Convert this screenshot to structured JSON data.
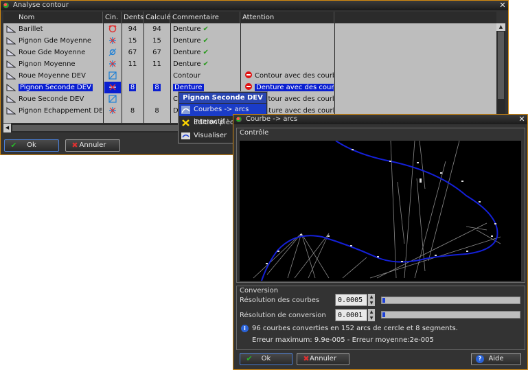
{
  "w1": {
    "title": "Analyse contour",
    "columns": [
      "Nom",
      "Cin.",
      "Dents",
      "Calculé",
      "Commentaire",
      "Attention"
    ],
    "rows": [
      {
        "name": "Barillet",
        "dents": "94",
        "calcule": "94",
        "comment": "Denture",
        "ok": true,
        "warning": ""
      },
      {
        "name": "Pignon Gde Moyenne",
        "dents": "15",
        "calcule": "15",
        "comment": "Denture",
        "ok": true,
        "warning": ""
      },
      {
        "name": "Roue Gde Moyenne",
        "dents": "67",
        "calcule": "67",
        "comment": "Denture",
        "ok": true,
        "warning": ""
      },
      {
        "name": "Pignon Moyenne",
        "dents": "11",
        "calcule": "11",
        "comment": "Denture",
        "ok": true,
        "warning": ""
      },
      {
        "name": "Roue Moyenne DEV",
        "dents": "",
        "calcule": "",
        "comment": "Contour",
        "ok": false,
        "warning": "Contour avec des courbes"
      },
      {
        "name": "Pignon Seconde DEV",
        "dents": "8",
        "calcule": "8",
        "comment": "Denture",
        "ok": false,
        "warning": "Denture avec des courbes",
        "selected": true
      },
      {
        "name": "Roue Seconde DEV",
        "dents": "",
        "calcule": "",
        "comment": "Co",
        "ok": false,
        "warning": "Contour avec des courbes"
      },
      {
        "name": "Pignon Echappement DEV",
        "dents": "8",
        "calcule": "8",
        "comment": "De",
        "ok": false,
        "warning": "Denture avec des courbes"
      }
    ],
    "ok_label": "Ok",
    "cancel_label": "Annuler"
  },
  "context_menu": {
    "header": "Pignon Seconde DEV",
    "items": [
      "Courbes -> arcs interactif",
      "Edition pièce",
      "Visualiser"
    ]
  },
  "w2": {
    "title": "Courbe -> arcs",
    "group_control": "Contrôle",
    "group_conversion": "Conversion",
    "curve_res_label": "Résolution des courbes",
    "curve_res_value": "0.0005",
    "conv_res_label": "Résolution de conversion",
    "conv_res_value": "0.0001",
    "info_line1": "96 courbes converties en 152 arcs de cercle et 8 segments.",
    "info_line2": "Erreur maximum: 9.9e-005 - Erreur moyenne:2e-005",
    "ok_label": "Ok",
    "cancel_label": "Annuler",
    "help_label": "Aide"
  },
  "colors": {
    "accent_border": "#d48a10",
    "selection": "#0a1fd0",
    "error": "#e01010",
    "ok": "#2a9a1e"
  }
}
